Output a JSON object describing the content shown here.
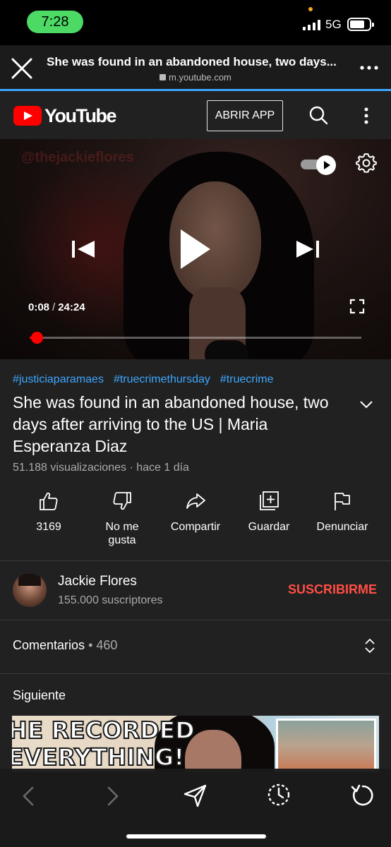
{
  "status_bar": {
    "time": "7:28",
    "network": "5G",
    "icons": [
      "signal-icon",
      "battery-icon"
    ]
  },
  "browser": {
    "page_title": "She was found in an abandoned house, two days...",
    "url": "m.youtube.com",
    "icons": [
      "close-icon",
      "lock-icon",
      "more-icon"
    ]
  },
  "yt_header": {
    "logo_text": "YouTube",
    "open_app_label": "ABRIR APP",
    "icons": [
      "search-icon",
      "kebab-icon"
    ]
  },
  "player": {
    "watermark": "@thejackieflores",
    "current_time": "0:08",
    "time_separator": "/",
    "duration": "24:24",
    "progress_fraction": 0.018,
    "autoplay_on": true,
    "icons": [
      "autoplay-toggle-icon",
      "settings-icon",
      "previous-icon",
      "play-icon",
      "next-icon",
      "fullscreen-icon"
    ]
  },
  "video": {
    "hashtags": [
      "#justiciaparamaes",
      "#truecrimethursday",
      "#truecrime"
    ],
    "title": "She was found in an abandoned house, two days after arriving to the US | Maria Esperanza Diaz",
    "meta": "51.188 visualizaciones · hace 1 día"
  },
  "actions": {
    "like": "3169",
    "dislike": "No me gusta",
    "share": "Compartir",
    "save": "Guardar",
    "report": "Denunciar"
  },
  "channel": {
    "name": "Jackie Flores",
    "subscribers": "155.000 suscriptores",
    "subscribe_label": "SUSCRIBIRME"
  },
  "comments": {
    "label": "Comentarios",
    "separator": "•",
    "count": "460"
  },
  "up_next": {
    "label": "Siguiente",
    "thumbnail_text_line1": "HE RECORDED",
    "thumbnail_text_line2": "EVERYTHING!"
  },
  "colors": {
    "accent_red": "#ff0000",
    "subscribe_red": "#ff4e45",
    "hashtag_blue": "#3ea6ff",
    "time_pill_green": "#4cd964",
    "background": "#212121"
  }
}
